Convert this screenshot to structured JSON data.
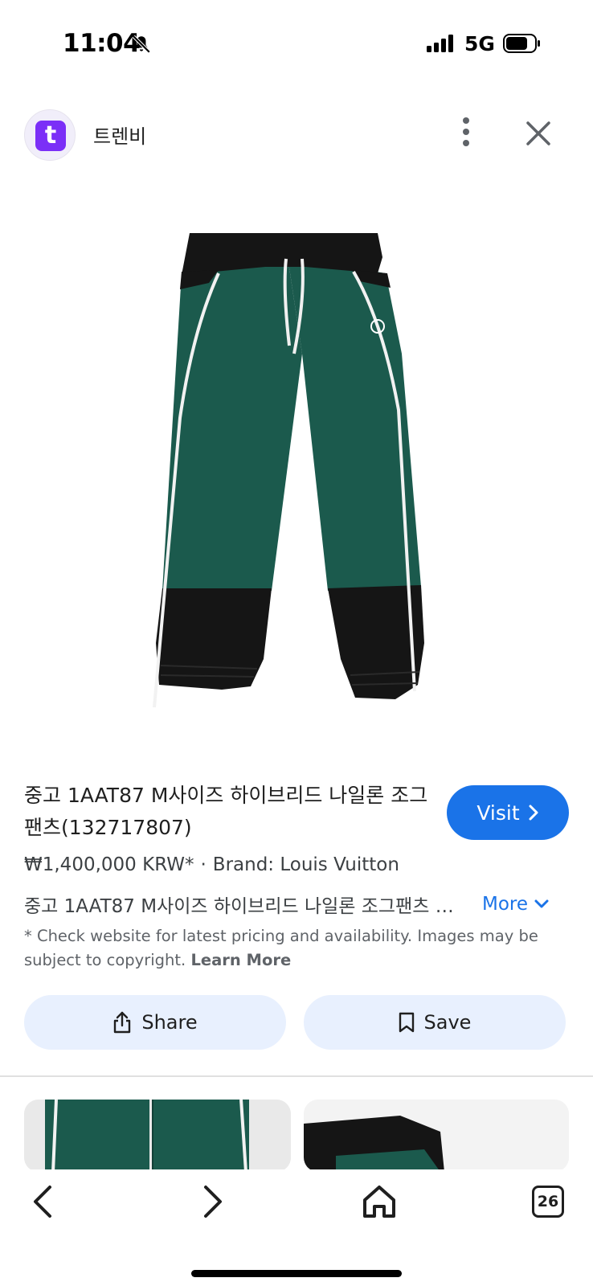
{
  "status_bar": {
    "time": "11:04",
    "network": "5G",
    "icons": [
      "bell-off-icon",
      "signal-icon",
      "battery-icon"
    ]
  },
  "header": {
    "site_logo_letter": "t",
    "site_name": "트렌비",
    "icons": [
      "more-vert-icon",
      "close-icon"
    ]
  },
  "product": {
    "title": "중고 1AAT87 M사이즈 하이브리드 나일론 조그팬츠(132717807)",
    "visit_label": "Visit",
    "price": "₩1,400,000 KRW*",
    "separator": "·",
    "brand": "Brand: Louis Vuitton",
    "description": "중고 1AAT87 M사이즈 하이브리드 나일론 조그팬츠 …",
    "more_label": "More",
    "disclaimer": "* Check website for latest pricing and availability. Images may be subject to copyright.",
    "learn_more": "Learn More"
  },
  "actions": {
    "share_label": "Share",
    "save_label": "Save"
  },
  "bottom_nav": {
    "tab_count": "26",
    "icons": [
      "back-icon",
      "forward-icon",
      "home-icon",
      "tabs-icon"
    ]
  },
  "colors": {
    "accent": "#1a73e8",
    "button_bg": "#e8f0fe",
    "logo": "#7b2ff7",
    "pants_green": "#1b5a4d",
    "pants_black": "#151515"
  }
}
